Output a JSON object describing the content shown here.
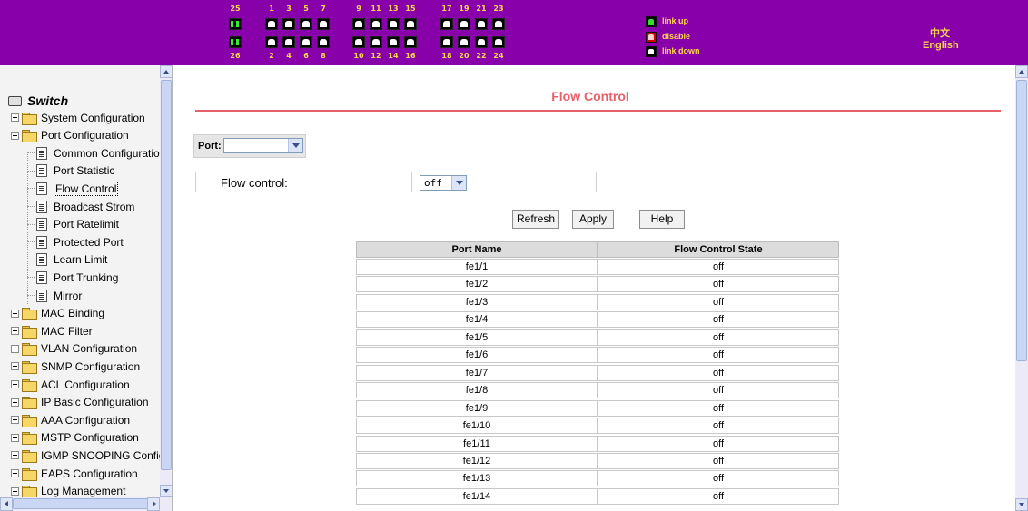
{
  "banner": {
    "colors": {
      "background": "#8800aa",
      "label": "#ffd84a"
    },
    "port_top_numbers": [
      "25",
      "1",
      "3",
      "5",
      "7",
      "9",
      "11",
      "13",
      "15",
      "17",
      "19",
      "21",
      "23"
    ],
    "port_bottom_numbers": [
      "26",
      "2",
      "4",
      "6",
      "8",
      "10",
      "12",
      "14",
      "16",
      "18",
      "20",
      "22",
      "24"
    ],
    "legend": {
      "link_up": "link up",
      "disable": "disable",
      "link_down": "link down"
    },
    "lang_chinese": "中文",
    "lang_english": "English"
  },
  "tree": {
    "root_label": "Switch",
    "items": [
      {
        "label": "System Configuration",
        "type": "folder",
        "expanded": false
      },
      {
        "label": "Port Configuration",
        "type": "folder",
        "expanded": true
      },
      {
        "label": "Common Configuration",
        "type": "page"
      },
      {
        "label": "Port Statistic",
        "type": "page"
      },
      {
        "label": "Flow Control",
        "type": "page",
        "selected": true
      },
      {
        "label": "Broadcast Strom",
        "type": "page"
      },
      {
        "label": "Port Ratelimit",
        "type": "page"
      },
      {
        "label": "Protected Port",
        "type": "page"
      },
      {
        "label": "Learn Limit",
        "type": "page"
      },
      {
        "label": "Port Trunking",
        "type": "page"
      },
      {
        "label": "Mirror",
        "type": "page"
      },
      {
        "label": "MAC Binding",
        "type": "folder",
        "expanded": false
      },
      {
        "label": "MAC Filter",
        "type": "folder",
        "expanded": false
      },
      {
        "label": "VLAN Configuration",
        "type": "folder",
        "expanded": false
      },
      {
        "label": "SNMP Configuration",
        "type": "folder",
        "expanded": false
      },
      {
        "label": "ACL Configuration",
        "type": "folder",
        "expanded": false
      },
      {
        "label": "IP Basic Configuration",
        "type": "folder",
        "expanded": false
      },
      {
        "label": "AAA Configuration",
        "type": "folder",
        "expanded": false
      },
      {
        "label": "MSTP Configuration",
        "type": "folder",
        "expanded": false
      },
      {
        "label": "IGMP SNOOPING Config",
        "type": "folder",
        "expanded": false
      },
      {
        "label": "EAPS Configuration",
        "type": "folder",
        "expanded": false
      },
      {
        "label": "Log Management",
        "type": "folder",
        "expanded": false
      }
    ]
  },
  "main": {
    "title": "Flow Control",
    "title_color": "#e8606a",
    "port_label": "Port:",
    "port_value": "",
    "flow_control_label": "Flow control:",
    "flow_control_value": "off",
    "buttons": {
      "refresh": "Refresh",
      "apply": "Apply",
      "help": "Help"
    },
    "table": {
      "headers": [
        "Port Name",
        "Flow Control State"
      ],
      "rows": [
        [
          "fe1/1",
          "off"
        ],
        [
          "fe1/2",
          "off"
        ],
        [
          "fe1/3",
          "off"
        ],
        [
          "fe1/4",
          "off"
        ],
        [
          "fe1/5",
          "off"
        ],
        [
          "fe1/6",
          "off"
        ],
        [
          "fe1/7",
          "off"
        ],
        [
          "fe1/8",
          "off"
        ],
        [
          "fe1/9",
          "off"
        ],
        [
          "fe1/10",
          "off"
        ],
        [
          "fe1/11",
          "off"
        ],
        [
          "fe1/12",
          "off"
        ],
        [
          "fe1/13",
          "off"
        ],
        [
          "fe1/14",
          "off"
        ]
      ]
    }
  }
}
